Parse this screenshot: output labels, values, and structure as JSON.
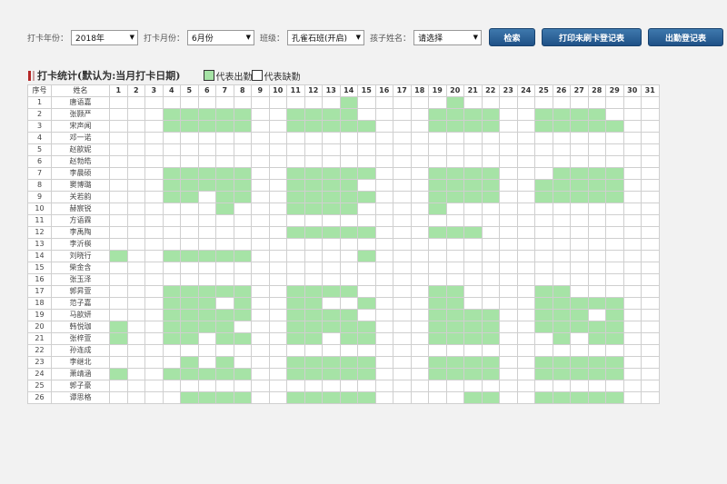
{
  "filters": {
    "year": {
      "label": "打卡年份：",
      "value": "2018年"
    },
    "month": {
      "label": "打卡月份：",
      "value": "6月份"
    },
    "class": {
      "label": "班级：",
      "value": "孔雀石班(开启)"
    },
    "child": {
      "label": "孩子姓名：",
      "value": "请选择"
    }
  },
  "buttons": {
    "search": "检索",
    "print_unswiped": "打印未刷卡登记表",
    "attendance_sheet": "出勤登记表"
  },
  "section_title": "打卡统计(默认为:当月打卡日期)",
  "legend": {
    "present": "代表出勤",
    "absent": "代表缺勤"
  },
  "colors": {
    "present": "#a6e3a6",
    "button": "#2a5f96",
    "title_mark": "#b52828"
  },
  "table": {
    "headers": {
      "no": "序号",
      "name": "姓名"
    },
    "days": [
      1,
      2,
      3,
      4,
      5,
      6,
      7,
      8,
      9,
      10,
      11,
      12,
      13,
      14,
      15,
      16,
      17,
      18,
      19,
      20,
      21,
      22,
      23,
      24,
      25,
      26,
      27,
      28,
      29,
      30,
      31
    ],
    "rows": [
      {
        "no": "1",
        "name": "唐语嘉",
        "present": [
          14,
          20
        ]
      },
      {
        "no": "2",
        "name": "张颢严",
        "present": [
          4,
          5,
          6,
          7,
          8,
          11,
          12,
          13,
          14,
          19,
          20,
          21,
          22,
          25,
          26,
          27,
          28
        ]
      },
      {
        "no": "3",
        "name": "宋声闻",
        "present": [
          4,
          5,
          6,
          7,
          8,
          11,
          12,
          13,
          14,
          15,
          19,
          20,
          21,
          22,
          25,
          26,
          27,
          28,
          29
        ]
      },
      {
        "no": "4",
        "name": "邓一诺",
        "present": []
      },
      {
        "no": "5",
        "name": "赵歆妮",
        "present": []
      },
      {
        "no": "6",
        "name": "赵勃皓",
        "present": []
      },
      {
        "no": "7",
        "name": "李晨硕",
        "present": [
          4,
          5,
          6,
          7,
          8,
          11,
          12,
          13,
          14,
          15,
          19,
          20,
          21,
          22,
          26,
          27,
          28,
          29
        ]
      },
      {
        "no": "8",
        "name": "窦博璐",
        "present": [
          4,
          5,
          6,
          7,
          8,
          11,
          12,
          13,
          14,
          19,
          20,
          21,
          22,
          25,
          26,
          27,
          28,
          29
        ]
      },
      {
        "no": "9",
        "name": "关若韵",
        "present": [
          4,
          5,
          7,
          8,
          11,
          12,
          13,
          14,
          15,
          19,
          20,
          21,
          22,
          25,
          26,
          27,
          28,
          29
        ]
      },
      {
        "no": "10",
        "name": "赫宸锐",
        "present": [
          7,
          11,
          12,
          13,
          14,
          19
        ]
      },
      {
        "no": "11",
        "name": "方语霖",
        "present": []
      },
      {
        "no": "12",
        "name": "李禹陶",
        "present": [
          11,
          12,
          13,
          14,
          15,
          19,
          20,
          21
        ]
      },
      {
        "no": "13",
        "name": "李沂楧",
        "present": []
      },
      {
        "no": "14",
        "name": "刘晓行",
        "present": [
          1,
          4,
          5,
          6,
          7,
          8,
          15
        ]
      },
      {
        "no": "15",
        "name": "柴金含",
        "present": []
      },
      {
        "no": "16",
        "name": "张玉泽",
        "present": []
      },
      {
        "no": "17",
        "name": "郭昇萱",
        "present": [
          4,
          5,
          6,
          7,
          8,
          11,
          12,
          13,
          14,
          19,
          20,
          25,
          26
        ]
      },
      {
        "no": "18",
        "name": "范子嘉",
        "present": [
          4,
          5,
          6,
          8,
          11,
          12,
          15,
          19,
          20,
          25,
          26,
          27,
          28,
          29
        ]
      },
      {
        "no": "19",
        "name": "马歆妍",
        "present": [
          4,
          5,
          6,
          7,
          8,
          11,
          12,
          13,
          14,
          19,
          20,
          21,
          22,
          25,
          26,
          27,
          29
        ]
      },
      {
        "no": "20",
        "name": "韩悦珈",
        "present": [
          1,
          4,
          5,
          6,
          7,
          11,
          12,
          13,
          14,
          15,
          19,
          20,
          21,
          22,
          25,
          26,
          27,
          28,
          29
        ]
      },
      {
        "no": "21",
        "name": "张梓萱",
        "present": [
          1,
          4,
          5,
          7,
          8,
          11,
          12,
          14,
          15,
          19,
          20,
          21,
          22,
          26,
          28,
          29
        ]
      },
      {
        "no": "22",
        "name": "孙连成",
        "present": []
      },
      {
        "no": "23",
        "name": "李继北",
        "present": [
          5,
          7,
          11,
          12,
          13,
          14,
          15,
          19,
          20,
          21,
          22,
          25,
          26,
          27,
          28,
          29
        ]
      },
      {
        "no": "24",
        "name": "萧靖涵",
        "present": [
          1,
          4,
          5,
          6,
          7,
          8,
          11,
          12,
          13,
          14,
          15,
          19,
          20,
          21,
          22,
          25,
          26,
          27,
          28,
          29
        ]
      },
      {
        "no": "25",
        "name": "郭子豪",
        "present": []
      },
      {
        "no": "26",
        "name": "谭思格",
        "present": [
          5,
          6,
          7,
          8,
          11,
          12,
          13,
          14,
          15,
          21,
          22,
          25,
          26,
          27,
          28,
          29
        ]
      }
    ]
  }
}
